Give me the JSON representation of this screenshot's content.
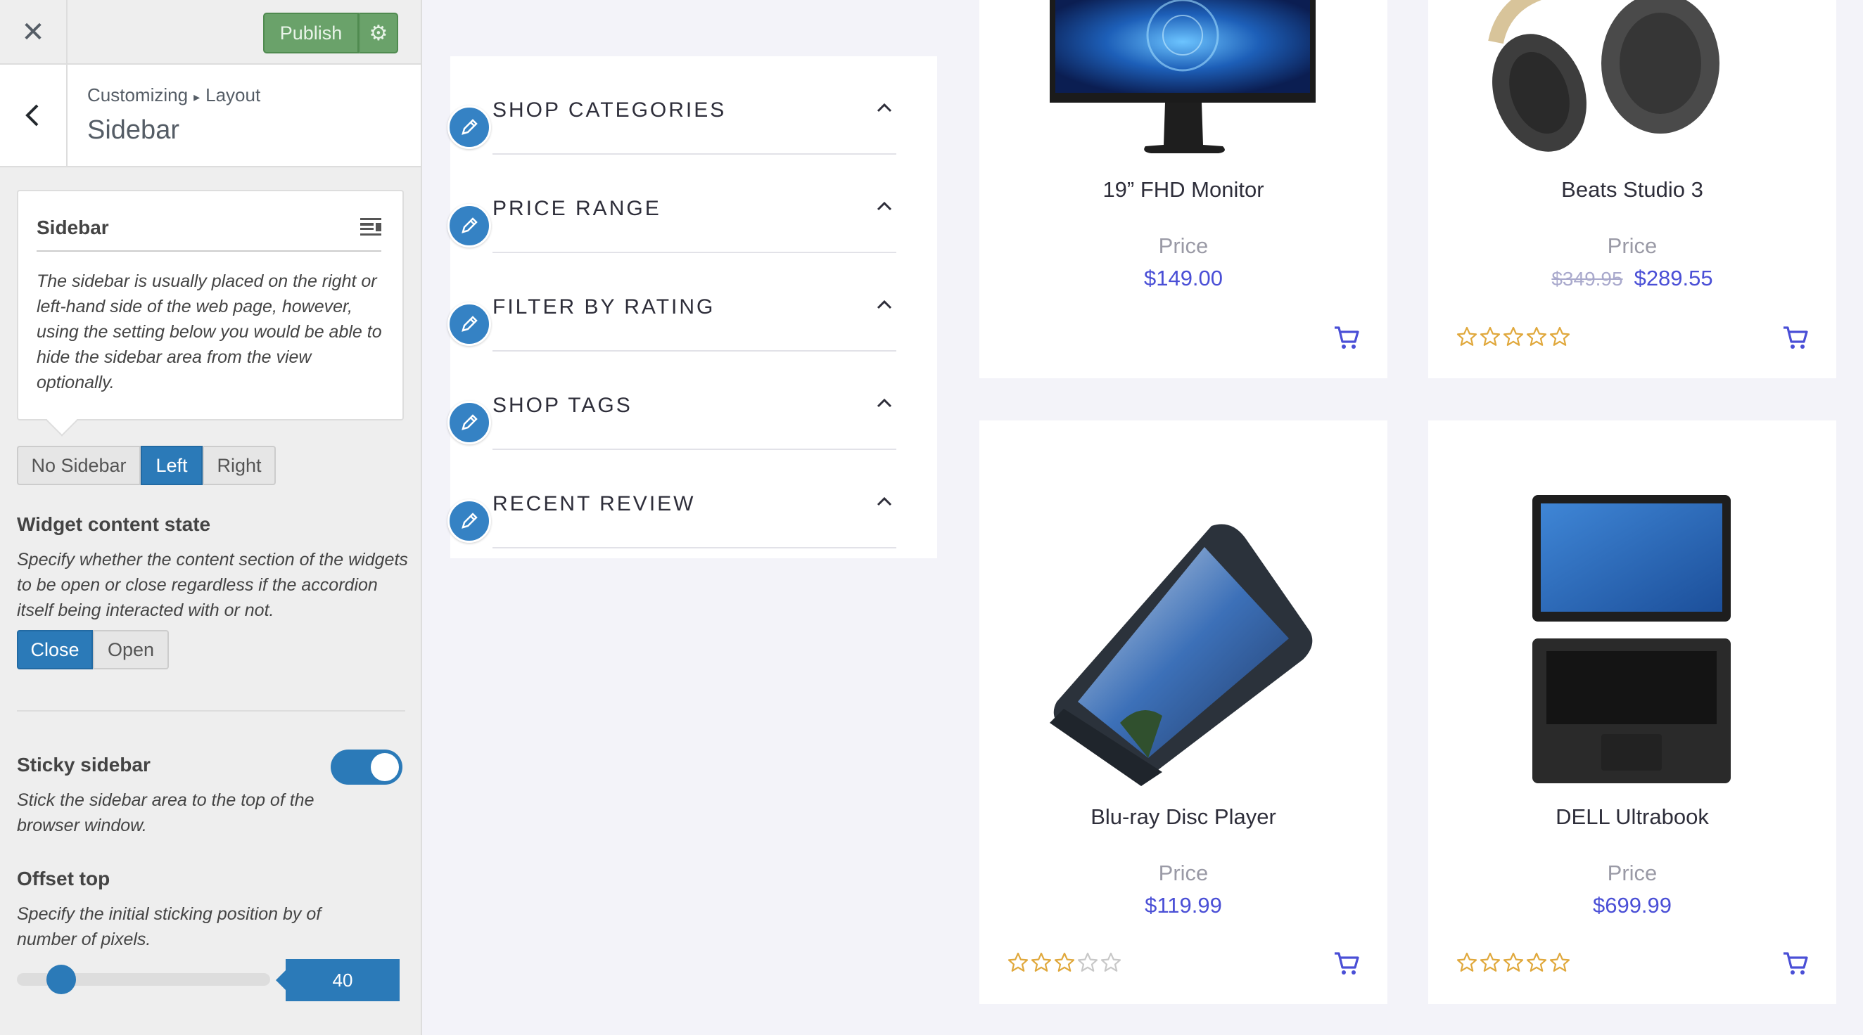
{
  "header": {
    "close_label": "✕",
    "publish_label": "Publish",
    "settings_icon": "gear-icon"
  },
  "section": {
    "breadcrumb_root": "Customizing",
    "breadcrumb_sep": "▸",
    "breadcrumb_current": "Layout",
    "title": "Sidebar"
  },
  "info": {
    "title": "Sidebar",
    "description": "The sidebar is usually placed on the right or left-hand side of the web page, however, using the setting below you would be able to hide the sidebar area from the view optionally."
  },
  "sidebar_position": {
    "options": [
      "No Sidebar",
      "Left",
      "Right"
    ],
    "selected": "Left"
  },
  "widget_state": {
    "label": "Widget content state",
    "description": "Specify whether the content section of the widgets to be open or close regardless if the accordion itself being interacted with or not.",
    "options": [
      "Close",
      "Open"
    ],
    "selected": "Close"
  },
  "sticky": {
    "label": "Sticky sidebar",
    "description": "Stick the sidebar area to the top of the browser window.",
    "enabled": true
  },
  "offset": {
    "label": "Offset top",
    "description": "Specify the initial sticking position by of number of pixels.",
    "value": "40"
  },
  "widgets": [
    {
      "title": "SHOP CATEGORIES"
    },
    {
      "title": "PRICE RANGE"
    },
    {
      "title": "FILTER BY RATING"
    },
    {
      "title": "SHOP TAGS"
    },
    {
      "title": "RECENT REVIEW"
    }
  ],
  "products": [
    {
      "name": "19” FHD Monitor",
      "price_label": "Price",
      "old_price": "",
      "price": "$149.00",
      "rating": null
    },
    {
      "name": "Beats Studio 3",
      "price_label": "Price",
      "old_price": "$349.95",
      "price": "$289.55",
      "rating": 0
    },
    {
      "name": "Blu-ray Disc Player",
      "price_label": "Price",
      "old_price": "",
      "price": "$119.99",
      "rating": 3
    },
    {
      "name": "DELL Ultrabook",
      "price_label": "Price",
      "old_price": "",
      "price": "$699.99",
      "rating": 0
    }
  ],
  "colors": {
    "accent": "#2b7ab8",
    "publish": "#6aa26a",
    "price": "#4a4fd6",
    "star": "#e0a83c"
  }
}
